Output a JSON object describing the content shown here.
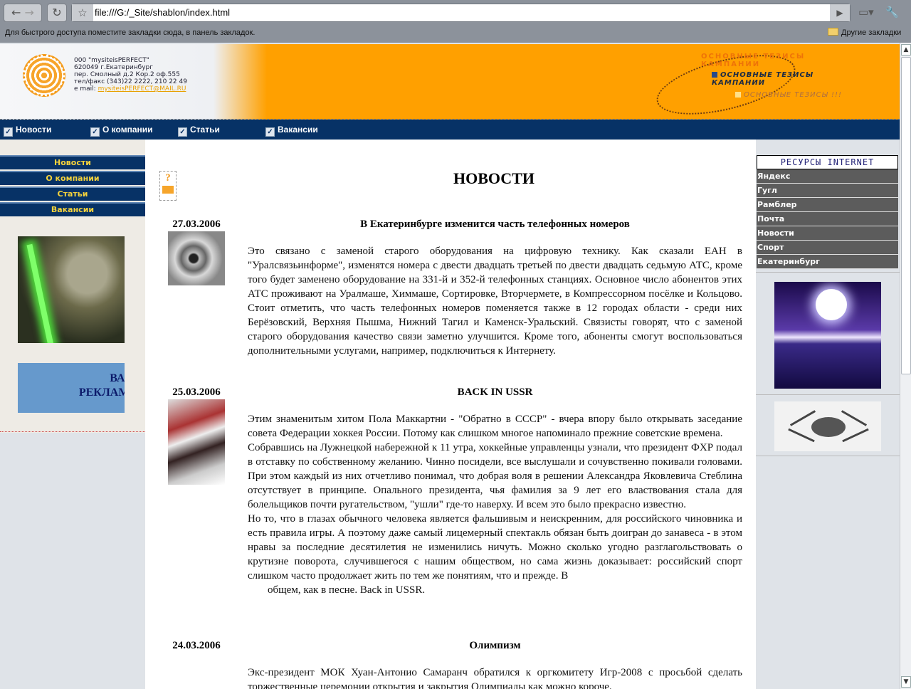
{
  "browser": {
    "url": "file:///G:/_Site/shablon/index.html",
    "bookmarks_hint": "Для быстрого доступа поместите закладки сюда, в панель закладок.",
    "other_bookmarks": "Другие закладки"
  },
  "header": {
    "company": "000 \"mysiteisPERFECT\"",
    "address1": "620049 г.Екатеринбург",
    "address2": "пер. Смолный д.2 Кор.2 оф.555",
    "phone": "тел/факс (343)22 2222, 210 22 49",
    "email_label": "e mail:",
    "email": "mysiteisPERFECT@MAIL.RU",
    "thesis_top": "ОСНОВНЫЕ ТЕЗИСЫ КАМПАНИИ",
    "thesis_main": "ОСНОВНЫЕ ТЕЗИСЫ КАМПАНИИ",
    "thesis_sub": "ОСНОВНЫЕ ТЕЗИСЫ !!!"
  },
  "nav": [
    "Новости",
    "О компании",
    "Статьи",
    "Вакансии"
  ],
  "sidebar": {
    "items": [
      "Новости",
      "О компании",
      "Статьи",
      "Вакансии"
    ],
    "ad_text": [
      "ВАШ",
      "РЕКЛАМА"
    ]
  },
  "main": {
    "title": "НОВОСТИ",
    "articles": [
      {
        "date": "27.03.2006",
        "title": "В Екатеринбурге изменится часть телефонных номеров",
        "paragraphs": [
          "Это связано с заменой старого оборудования на цифровую технику. Как сказали ЕАН в \"Уралсвязьинформе\", изменятся номера с двести двадцать третьей по двести двадцать седьмую АТС, кроме того будет заменено оборудование на 331-й и 352-й телефонных станциях. Основное число абонентов этих АТС проживают на Уралмаше, Химмаше, Сортировке, Вторчермете, в Компрессорном посёлке и Кольцово. Стоит отметить, что часть телефонных номеров поменяется также в 12 городах области - среди них Берёзовский, Верхняя Пышма, Нижний Тагил и Каменск-Уральский. Связисты говорят, что с заменой старого оборудования качество связи заметно улучшится. Кроме того, абоненты смогут воспользоваться дополнительными услугами, например, подключиться к Интернету."
        ]
      },
      {
        "date": "25.03.2006",
        "title": "BACK IN USSR",
        "paragraphs": [
          "Этим знаменитым хитом Пола Маккартни - \"Обратно в СССР\" - вчера впору было открывать заседание совета Федерации хоккея России. Потому как слишком многое напоминало прежние советские времена.",
          "Собравшись на Лужнецкой набережной к 11 утра, хоккейные управленцы узнали, что президент ФХР подал в отставку по собственному желанию. Чинно посидели, все выслушали и сочувственно покивали головами. При этом каждый из них отчетливо понимал, что добрая воля в решении Александра Яковлевича Стеблина отсутствует в принципе. Опального президента, чья фамилия за 9 лет его властвования стала для болельщиков почти ругательством, \"ушли\" где-то наверху. И всем это было прекрасно известно.",
          "Но то, что в глазах обычного человека является фальшивым и неискренним, для российского чиновника и есть правила игры. А поэтому даже самый лицемерный спектакль обязан быть доигран до занавеса - в этом нравы за последние десятилетия не изменились ничуть. Можно сколько угодно разглагольствовать о крутизне поворота, случившегося с нашим обществом, но сама жизнь доказывает: российский спорт слишком часто продолжает жить по тем же понятиям, что и прежде. В",
          "общем, как в песне. Back in USSR."
        ]
      },
      {
        "date": "24.03.2006",
        "title": "Олимпизм",
        "paragraphs": [
          "Экс-президент МОК Хуан-Антонио Самаранч обратился к оргкомитету Игр-2008 с просьбой сделать торжественные церемонии открытия и закрытия Олимпиады как можно короче."
        ]
      }
    ]
  },
  "resources": {
    "title": "РЕСУРСЫ INTERNET",
    "items": [
      "Яндекс",
      "Гугл",
      "Рамблер",
      "Почта",
      "Новости",
      "Спорт",
      "Екатеринбург"
    ]
  }
}
